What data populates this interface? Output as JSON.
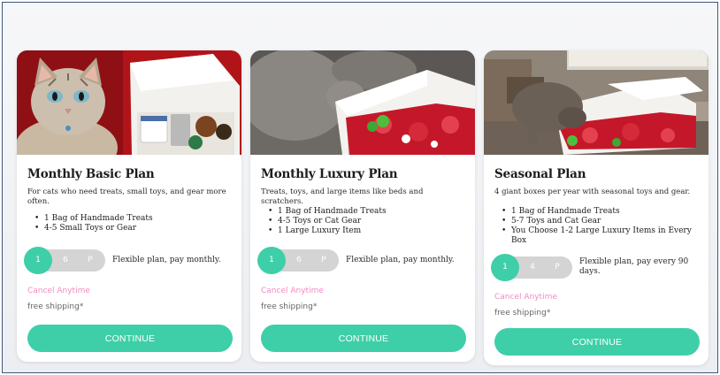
{
  "plans": [
    {
      "title": "Monthly Basic Plan",
      "description": "For cats who need treats, small toys, and gear more often.",
      "features": [
        "1 Bag of Handmade Treats",
        "4-5 Small Toys or Gear"
      ],
      "toggle_options": [
        "1",
        "6",
        "P"
      ],
      "selected_option": "1",
      "plan_note": "Flexible plan, pay monthly.",
      "cancel_text": "Cancel Anytime",
      "shipping_text": "free shipping*",
      "button_label": "CONTINUE"
    },
    {
      "title": "Monthly Luxury Plan",
      "description": "Treats, toys, and large items like beds and scratchers.",
      "features": [
        "1 Bag of Handmade Treats",
        "4-5 Toys or Cat Gear",
        "1 Large Luxury Item"
      ],
      "toggle_options": [
        "1",
        "6",
        "P"
      ],
      "selected_option": "1",
      "plan_note": "Flexible plan, pay monthly.",
      "cancel_text": "Cancel Anytime",
      "shipping_text": "free shipping*",
      "button_label": "CONTINUE"
    },
    {
      "title": "Seasonal Plan",
      "description": "4 giant boxes per year with seasonal toys and gear.",
      "features": [
        "1 Bag of Handmade Treats",
        "5-7 Toys and Cat Gear",
        "You Choose 1-2 Large Luxury Items in Every Box"
      ],
      "toggle_options": [
        "1",
        "4",
        "P"
      ],
      "selected_option": "1",
      "plan_note": "Flexible plan, pay every 90 days.",
      "cancel_text": "Cancel Anytime",
      "shipping_text": "free shipping*",
      "button_label": "CONTINUE"
    }
  ],
  "colors": {
    "accent": "#3ecfa8",
    "cancel_link": "#f08bc3",
    "toggle_track": "#d4d4d4"
  }
}
